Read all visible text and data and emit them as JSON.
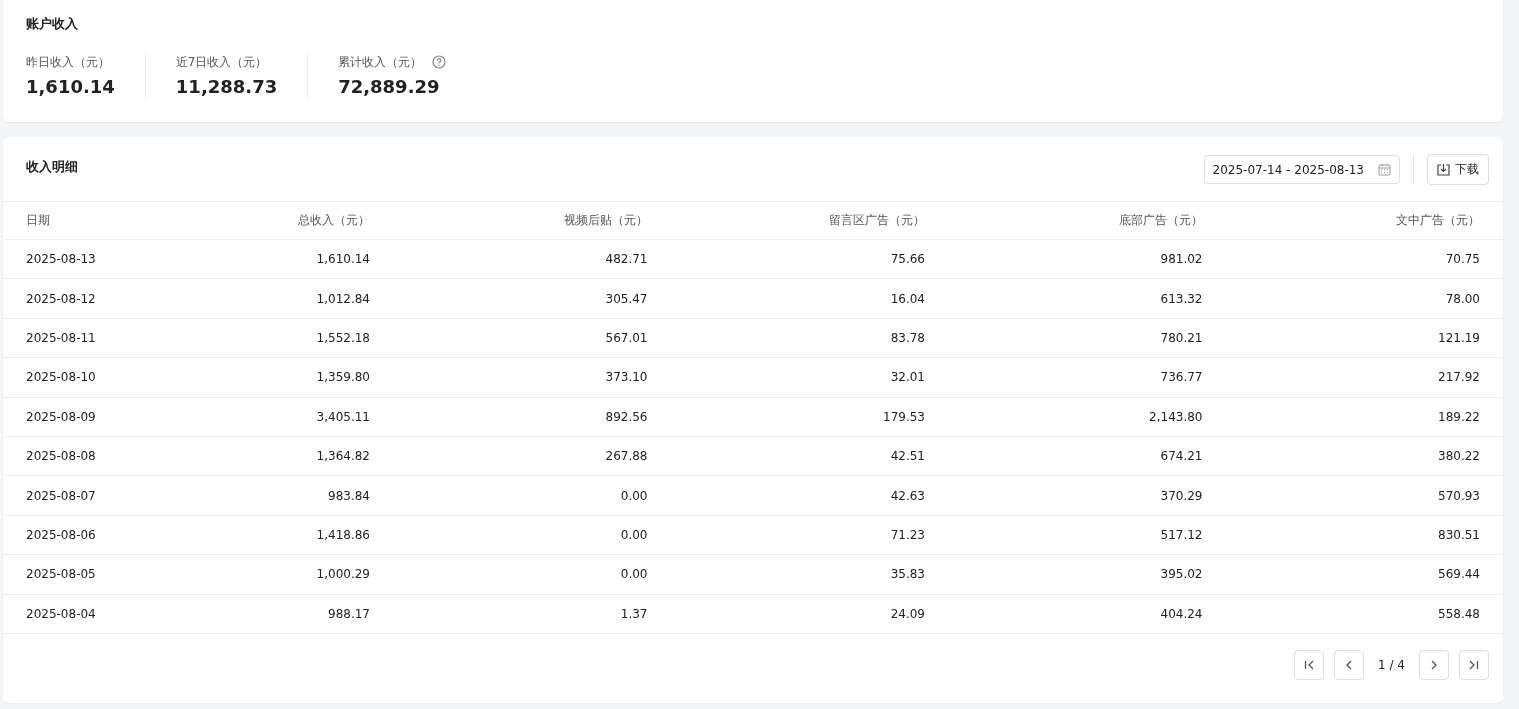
{
  "account": {
    "title": "账户收入",
    "stats": [
      {
        "label": "昨日收入（元）",
        "value": "1,610.14",
        "help": false
      },
      {
        "label": "近7日收入（元）",
        "value": "11,288.73",
        "help": false
      },
      {
        "label": "累计收入（元）",
        "value": "72,889.29",
        "help": true
      }
    ]
  },
  "detail": {
    "title": "收入明细",
    "date_range": "2025-07-14 - 2025-08-13",
    "download": "下载",
    "table": {
      "columns": [
        "日期",
        "总收入（元）",
        "视频后贴（元）",
        "留言区广告（元）",
        "底部广告（元）",
        "文中广告（元）"
      ],
      "rows": [
        [
          "2025-08-13",
          "1,610.14",
          "482.71",
          "75.66",
          "981.02",
          "70.75"
        ],
        [
          "2025-08-12",
          "1,012.84",
          "305.47",
          "16.04",
          "613.32",
          "78.00"
        ],
        [
          "2025-08-11",
          "1,552.18",
          "567.01",
          "83.78",
          "780.21",
          "121.19"
        ],
        [
          "2025-08-10",
          "1,359.80",
          "373.10",
          "32.01",
          "736.77",
          "217.92"
        ],
        [
          "2025-08-09",
          "3,405.11",
          "892.56",
          "179.53",
          "2,143.80",
          "189.22"
        ],
        [
          "2025-08-08",
          "1,364.82",
          "267.88",
          "42.51",
          "674.21",
          "380.22"
        ],
        [
          "2025-08-07",
          "983.84",
          "0.00",
          "42.63",
          "370.29",
          "570.93"
        ],
        [
          "2025-08-06",
          "1,418.86",
          "0.00",
          "71.23",
          "517.12",
          "830.51"
        ],
        [
          "2025-08-05",
          "1,000.29",
          "0.00",
          "35.83",
          "395.02",
          "569.44"
        ],
        [
          "2025-08-04",
          "988.17",
          "1.37",
          "24.09",
          "404.24",
          "558.48"
        ]
      ]
    },
    "pagination": {
      "page": "1 / 4"
    }
  }
}
